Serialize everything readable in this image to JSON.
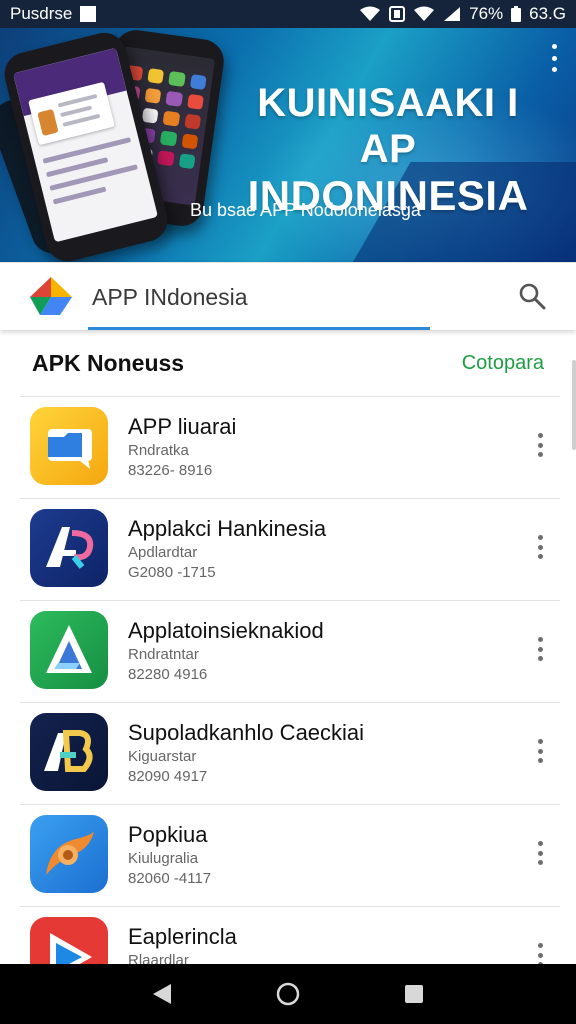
{
  "status_bar": {
    "left_text": "Pusdrse",
    "battery_text": "76%",
    "time": "63.G"
  },
  "banner": {
    "title_line1": "KUINISAAKI I AP",
    "title_line2": "INDONINESIA",
    "subtitle": "Bu bsae APP Nodolonelasga",
    "menu_icon": "more-vert-icon"
  },
  "search": {
    "value": "APP INdonesia",
    "logo_icon": "app-store-logo-icon",
    "search_icon": "search-icon"
  },
  "section": {
    "title": "APK Noneuss",
    "action": "Cotopara"
  },
  "apps": [
    {
      "name": "APP liuarai",
      "category": "Rndratka",
      "size": "83226- 8916",
      "icon": "folder-chat-icon"
    },
    {
      "name": "Applakci Hankinesia",
      "category": "Apdlardtar",
      "size": "G2080 -1715",
      "icon": "ap-logo-icon"
    },
    {
      "name": "Applatoinsieknakiod",
      "category": "Rndratntar",
      "size": "82280 4916",
      "icon": "triangle-logo-icon"
    },
    {
      "name": "Supoladkanhlo Caeckiai",
      "category": "Kiguarstar",
      "size": "82090 4917",
      "icon": "ab-logo-icon"
    },
    {
      "name": "Popkiua",
      "category": "Kiulugralia",
      "size": "82060 -4117",
      "icon": "swirl-logo-icon"
    },
    {
      "name": "Eaplerincla",
      "category": "Rlaardlar",
      "size": "",
      "icon": "play-logo-icon"
    }
  ],
  "nav": {
    "back_icon": "back-triangle-icon",
    "home_icon": "home-circle-icon",
    "recents_icon": "recents-square-icon"
  },
  "colors": {
    "accent_green": "#1e9e43",
    "search_underline": "#2c88d9",
    "banner_dark": "#0d3f7a",
    "banner_light": "#1ba0c6"
  }
}
